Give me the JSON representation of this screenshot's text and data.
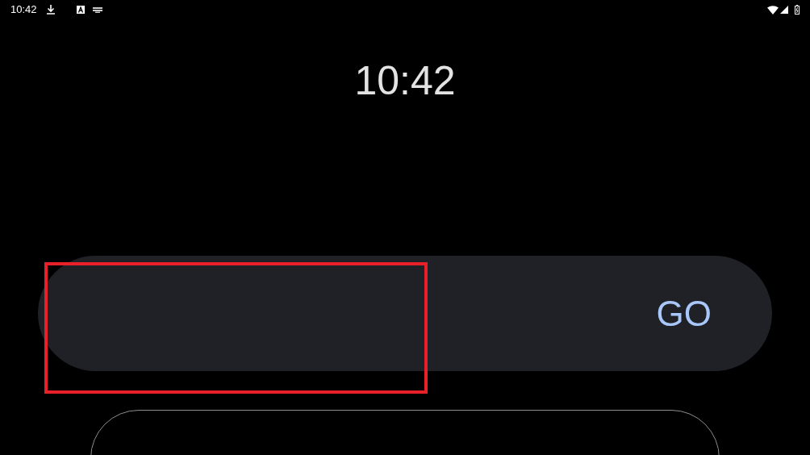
{
  "status_bar": {
    "time": "10:42"
  },
  "clock": "10:42",
  "entry": {
    "button": "GO",
    "highlighted": true
  }
}
